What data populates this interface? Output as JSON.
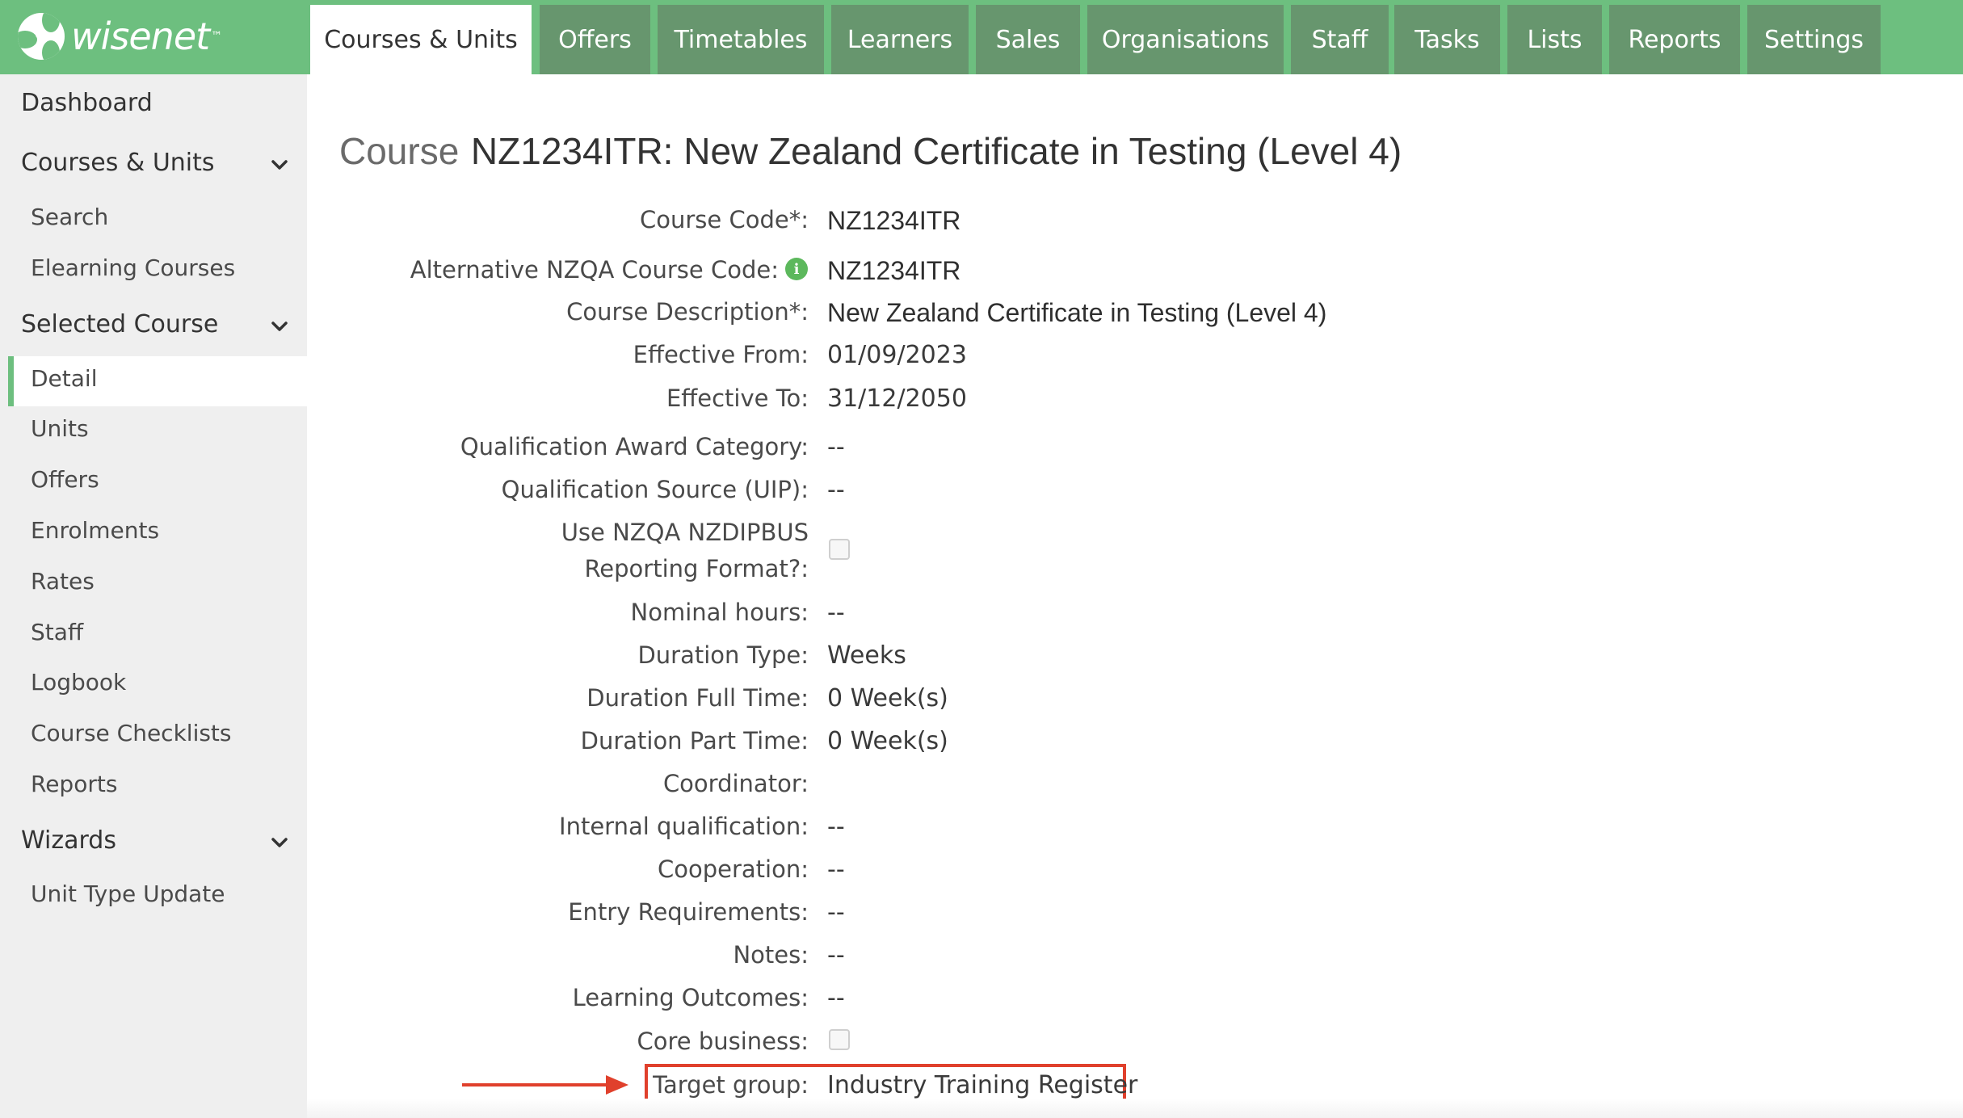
{
  "app": {
    "logo_text": "wisenet",
    "logo_tm": "™",
    "brand_color": "#6dbf7f",
    "tab_color": "#67966e",
    "highlight_color": "#e0402c"
  },
  "topnav": {
    "tabs": [
      {
        "label": "Courses & Units",
        "active": true
      },
      {
        "label": "Offers"
      },
      {
        "label": "Timetables"
      },
      {
        "label": "Learners"
      },
      {
        "label": "Sales"
      },
      {
        "label": "Organisations"
      },
      {
        "label": "Staff"
      },
      {
        "label": "Tasks"
      },
      {
        "label": "Lists"
      },
      {
        "label": "Reports"
      },
      {
        "label": "Settings"
      }
    ]
  },
  "sidebar": {
    "dashboard": "Dashboard",
    "courses_units": {
      "label": "Courses & Units",
      "items": [
        "Search",
        "Elearning Courses"
      ]
    },
    "selected_course": {
      "label": "Selected Course",
      "items": [
        "Detail",
        "Units",
        "Offers",
        "Enrolments",
        "Rates",
        "Staff",
        "Logbook",
        "Course Checklists",
        "Reports"
      ],
      "active": "Detail"
    },
    "wizards": {
      "label": "Wizards",
      "items": [
        "Unit Type Update"
      ]
    }
  },
  "main": {
    "title_prefix": "Course",
    "title_rest": "NZ1234ITR: New Zealand Certificate in Testing (Level 4)",
    "fields": {
      "course_code": {
        "label": "Course Code*:",
        "value": "NZ1234ITR"
      },
      "alt_code": {
        "label": "Alternative NZQA Course Code:",
        "value": "NZ1234ITR",
        "icon": "info-icon"
      },
      "description": {
        "label": "Course Description*:",
        "value": "New Zealand Certificate in Testing (Level 4)"
      },
      "effective_from": {
        "label": "Effective From:",
        "value": "01/09/2023"
      },
      "effective_to": {
        "label": "Effective To:",
        "value": "31/12/2050"
      },
      "award_category": {
        "label": "Qualification Award Category:",
        "value": "--"
      },
      "source_uip": {
        "label": "Qualification Source (UIP):",
        "value": "--"
      },
      "nzdipbus_line1": "Use NZQA NZDIPBUS",
      "nzdipbus_line2": "Reporting Format?:",
      "nzdipbus_checked": false,
      "nominal_hours": {
        "label": "Nominal hours:",
        "value": "--"
      },
      "duration_type": {
        "label": "Duration Type:",
        "value": "Weeks"
      },
      "duration_full": {
        "label": "Duration Full Time:",
        "value": "0 Week(s)"
      },
      "duration_part": {
        "label": "Duration Part Time:",
        "value": "0 Week(s)"
      },
      "coordinator": {
        "label": "Coordinator:",
        "value": ""
      },
      "internal_qual": {
        "label": "Internal qualification:",
        "value": "--"
      },
      "cooperation": {
        "label": "Cooperation:",
        "value": "--"
      },
      "entry_req": {
        "label": "Entry Requirements:",
        "value": "--"
      },
      "notes": {
        "label": "Notes:",
        "value": "--"
      },
      "learning_outcomes": {
        "label": "Learning Outcomes:",
        "value": "--"
      },
      "core_business": {
        "label": "Core business:",
        "checked": false
      },
      "target_group": {
        "label": "Target group:",
        "value": "Industry Training Register"
      }
    }
  }
}
